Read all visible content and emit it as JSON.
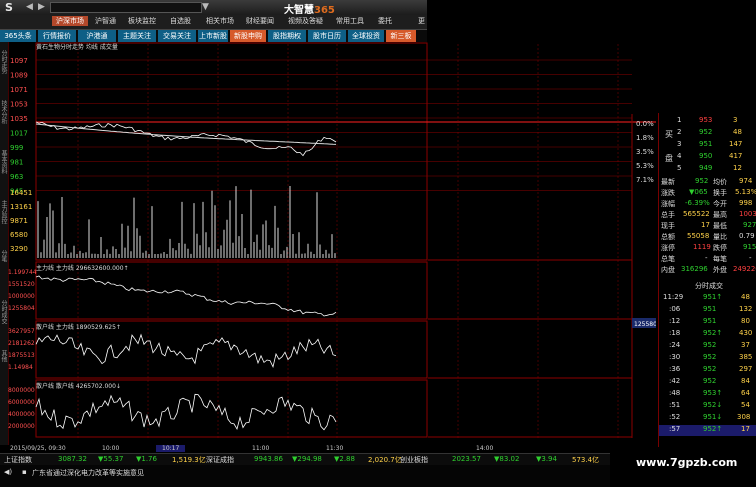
{
  "app": {
    "title_prefix": "大智慧",
    "title_suffix": "365",
    "logo": "S"
  },
  "main_menu": [
    {
      "label": "沪深市场",
      "active": true
    },
    {
      "label": "沪智通",
      "active": false
    },
    {
      "label": "板块监控",
      "active": false
    },
    {
      "label": "自选股",
      "active": false
    },
    {
      "label": "相关市场",
      "active": false
    },
    {
      "label": "财经要闻",
      "active": false
    },
    {
      "label": "视频及答疑",
      "active": false
    },
    {
      "label": "常用工具",
      "active": false
    },
    {
      "label": "委托",
      "active": false
    },
    {
      "label": "更",
      "active": false
    }
  ],
  "tabs": [
    {
      "label": "365头条",
      "active": false
    },
    {
      "label": "行情报价",
      "active": false
    },
    {
      "label": "沪港通",
      "active": false
    },
    {
      "label": "主题关注",
      "active": false
    },
    {
      "label": "交易关注",
      "active": false
    },
    {
      "label": "上市新股",
      "active": false
    },
    {
      "label": "新股申购",
      "active": true
    },
    {
      "label": "股指期权",
      "active": false
    },
    {
      "label": "股市日历",
      "active": false
    },
    {
      "label": "全球投资",
      "active": false
    },
    {
      "label": "新三板",
      "active": true
    }
  ],
  "left_bar": [
    "分时走势",
    "技术分析",
    "基本资料",
    "主力监控",
    "分笔",
    "分时成交",
    "其他"
  ],
  "chart_header": "黄石生物分时走势 均线 成交量",
  "price_axis": [
    "1097",
    "1089",
    "1071",
    "1053",
    "1035",
    "1017",
    "999",
    "981",
    "963",
    "945"
  ],
  "pct_axis": [
    "0.0%",
    "1.8%",
    "3.5%",
    "5.3%",
    "7.1%"
  ],
  "vol_axis": [
    "16451",
    "13161",
    "9871",
    "6580",
    "3290"
  ],
  "pane_titles": {
    "main_force": "主力线 主力线  296632600.000↑",
    "retail": "散户线 主力线  1890529.625↑",
    "retail_count": "散户线 散户线  4265702.000↓"
  },
  "main_force_axis": [
    "1.199744",
    "1551520",
    "1000000",
    "1255804"
  ],
  "retail_axis": [
    "3627957",
    "2181262",
    "1875513",
    "1.14984"
  ],
  "count_axis": [
    "8000000",
    "6000000",
    "4000000",
    "2000000"
  ],
  "time_axis": {
    "start": "2015/09/25, 09:30",
    "t1": "10:00",
    "t2": "10:17",
    "t3": "11:00",
    "t4": "11:30",
    "t5": "14:00"
  },
  "side_value": "1255804",
  "orderbook": {
    "buy_label": "买",
    "sell_label": "盘",
    "rows": [
      {
        "n": "1",
        "price": "953",
        "vol": "3"
      },
      {
        "n": "2",
        "price": "952",
        "vol": "48"
      },
      {
        "n": "3",
        "price": "951",
        "vol": "147"
      },
      {
        "n": "4",
        "price": "950",
        "vol": "417"
      },
      {
        "n": "5",
        "price": "949",
        "vol": "12"
      }
    ]
  },
  "stats": [
    {
      "k1": "最新",
      "v1": "952",
      "k2": "均价",
      "v2": "974"
    },
    {
      "k1": "涨跌",
      "v1": "▼065",
      "k2": "换手",
      "v2": "5.13%"
    },
    {
      "k1": "涨幅",
      "v1": "-6.39%",
      "k2": "今开",
      "v2": "998"
    },
    {
      "k1": "总手",
      "v1": "565522",
      "k2": "最高",
      "v2": "1003"
    },
    {
      "k1": "现手",
      "v1": "17",
      "k2": "最低",
      "v2": "927"
    },
    {
      "k1": "总额",
      "v1": "55058",
      "k2": "量比",
      "v2": "0.79"
    },
    {
      "k1": "涨停",
      "v1": "1119",
      "k2": "跌停",
      "v2": "915"
    },
    {
      "k1": "总笔",
      "v1": "-",
      "k2": "每笔",
      "v2": "-"
    },
    {
      "k1": "内盘",
      "v1": "316296",
      "k2": "外盘",
      "v2": "249226"
    }
  ],
  "ticks_header": "分时成交",
  "ticks": [
    {
      "t": "11:29",
      "p": "951↑",
      "v": "48"
    },
    {
      "t": ":06",
      "p": "951",
      "v": "132"
    },
    {
      "t": ":12",
      "p": "951",
      "v": "80"
    },
    {
      "t": ":18",
      "p": "952↑",
      "v": "430"
    },
    {
      "t": ":24",
      "p": "952",
      "v": "37"
    },
    {
      "t": ":30",
      "p": "952",
      "v": "385"
    },
    {
      "t": ":36",
      "p": "952",
      "v": "297"
    },
    {
      "t": ":42",
      "p": "952",
      "v": "84"
    },
    {
      "t": ":48",
      "p": "953↑",
      "v": "64"
    },
    {
      "t": ":51",
      "p": "952↓",
      "v": "54"
    },
    {
      "t": ":52",
      "p": "951↓",
      "v": "308"
    },
    {
      "t": ":57",
      "p": "952↑",
      "v": "17"
    }
  ],
  "market_bar": [
    {
      "label": "上证指数",
      "value": "3087.32",
      "chg": "▼55.37",
      "pct": "▼1.76",
      "amt": "1,519.3亿"
    },
    {
      "label": "深证成指",
      "value": "9943.86",
      "chg": "▼294.98",
      "pct": "▼2.88",
      "amt": "2,020.7亿"
    },
    {
      "label": "创业板指",
      "value": "2023.57",
      "chg": "▼83.02",
      "pct": "▼3.94",
      "amt": "573.4亿"
    }
  ],
  "news": "广东省通过深化电力改革等实施意见",
  "watermark": "www.7gpzb.com",
  "colors": {
    "accent": "#d65a2b",
    "tab": "#0e5f86",
    "grid": "#8b0000",
    "up": "#ff4040",
    "down": "#2fd12f",
    "price": "#ffd24a"
  }
}
